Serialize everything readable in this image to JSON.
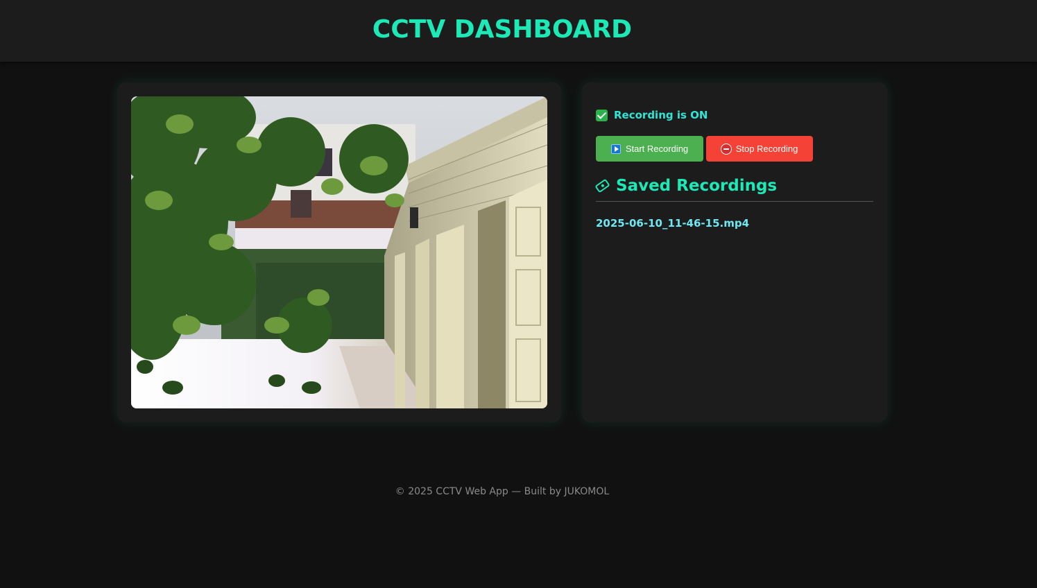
{
  "header": {
    "title": "CCTV DASHBOARD"
  },
  "video": {
    "feed_icon": "camera-feed"
  },
  "controls": {
    "status_icon": "check-icon",
    "status_text": "Recording is ON",
    "start_label": "Start Recording",
    "start_icon": "play-icon",
    "stop_label": "Stop Recording",
    "stop_icon": "stop-icon"
  },
  "recordings": {
    "heading": "Saved Recordings",
    "heading_icon": "tape-icon",
    "items": [
      "2025-06-10_11-46-15.mp4"
    ]
  },
  "footer": {
    "text": "© 2025 CCTV Web App — Built by JUKOMOL"
  },
  "colors": {
    "accent": "#1de9b6",
    "start_button": "#4caf50",
    "stop_button": "#f44336",
    "background": "#111111",
    "panel": "#1c1c1c"
  }
}
